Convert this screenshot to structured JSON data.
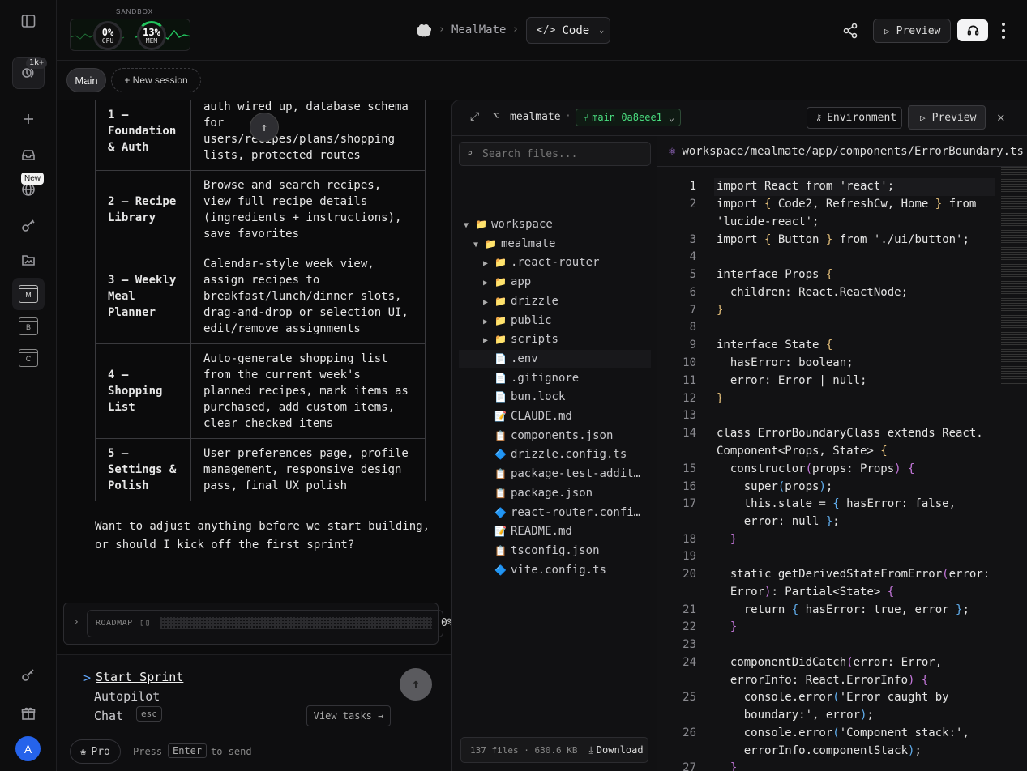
{
  "rail": {
    "activity_badge": "1k+",
    "new_badge": "New",
    "tiles": [
      "M",
      "B",
      "C"
    ],
    "avatar_letter": "A"
  },
  "header": {
    "sandbox_label": "SANDBOX",
    "cpu_value": "0%",
    "cpu_label": "CPU",
    "mem_value": "13%",
    "mem_label": "MEM",
    "breadcrumb_project": "MealMate",
    "mode_label": "Code",
    "preview_label": "Preview"
  },
  "sessions": {
    "main_label": "Main",
    "new_session_label": "+ New session"
  },
  "roadmap_table": [
    {
      "phase": "1 — Foundation & Auth",
      "desc": "auth wired up, database schema for users/recipes/plans/shopping lists, protected routes"
    },
    {
      "phase": "2 — Recipe Library",
      "desc": "Browse and search recipes, view full recipe details (ingredients + instructions), save favorites"
    },
    {
      "phase": "3 — Weekly Meal Planner",
      "desc": "Calendar-style week view, assign recipes to breakfast/lunch/dinner slots, drag-and-drop or selection UI, edit/remove assignments"
    },
    {
      "phase": "4 — Shopping List",
      "desc": "Auto-generate shopping list from the current week's planned recipes, mark items as purchased, add custom items, clear checked items"
    },
    {
      "phase": "5 — Settings & Polish",
      "desc": "User preferences page, profile management, responsive design pass, final UX polish"
    }
  ],
  "chat": {
    "question": "Want to adjust anything before we start building, or should I kick off the first sprint?",
    "roadmap_label": "ROADMAP",
    "roadmap_progress": "0%",
    "options": [
      "Start Sprint",
      "Autopilot",
      "Chat"
    ],
    "prompt_marker": ">",
    "esc_label": "esc",
    "view_tasks_label": "View tasks →",
    "pro_label": "Pro",
    "press_label": "Press",
    "enter_label": "Enter",
    "to_send_label": "to send"
  },
  "ide": {
    "repo_name": "mealmate",
    "branch": "main 0a8eee1",
    "environment_label": "Environment",
    "preview_label": "Preview",
    "search_placeholder": "Search files...",
    "file_path": "workspace/mealmate/app/components/ErrorBoundary.ts",
    "footer_info": "137 files · 630.6 KB",
    "download_label": "Download",
    "tree": [
      {
        "name": "workspace",
        "type": "folder-open",
        "depth": 0
      },
      {
        "name": "mealmate",
        "type": "folder-open",
        "depth": 1
      },
      {
        "name": ".react-router",
        "type": "folder",
        "depth": 2
      },
      {
        "name": "app",
        "type": "folder",
        "depth": 2
      },
      {
        "name": "drizzle",
        "type": "folder",
        "depth": 2
      },
      {
        "name": "public",
        "type": "folder",
        "depth": 2
      },
      {
        "name": "scripts",
        "type": "folder",
        "depth": 2
      },
      {
        "name": ".env",
        "type": "file",
        "depth": 2
      },
      {
        "name": ".gitignore",
        "type": "file",
        "depth": 2
      },
      {
        "name": "bun.lock",
        "type": "file",
        "depth": 2
      },
      {
        "name": "CLAUDE.md",
        "type": "md",
        "depth": 2
      },
      {
        "name": "components.json",
        "type": "json",
        "depth": 2
      },
      {
        "name": "drizzle.config.ts",
        "type": "ts",
        "depth": 2
      },
      {
        "name": "package-test-addit…",
        "type": "json",
        "depth": 2
      },
      {
        "name": "package.json",
        "type": "json",
        "depth": 2
      },
      {
        "name": "react-router.confi…",
        "type": "ts",
        "depth": 2
      },
      {
        "name": "README.md",
        "type": "md",
        "depth": 2
      },
      {
        "name": "tsconfig.json",
        "type": "json",
        "depth": 2
      },
      {
        "name": "vite.config.ts",
        "type": "ts",
        "depth": 2
      }
    ],
    "line_numbers": [
      "1",
      "2",
      "3",
      "4",
      "5",
      "6",
      "7",
      "8",
      "9",
      "10",
      "11",
      "12",
      "13",
      "14",
      "15",
      "16",
      "17",
      "18",
      "19",
      "20",
      "21",
      "22",
      "23",
      "24",
      "25",
      "26",
      "27"
    ]
  }
}
